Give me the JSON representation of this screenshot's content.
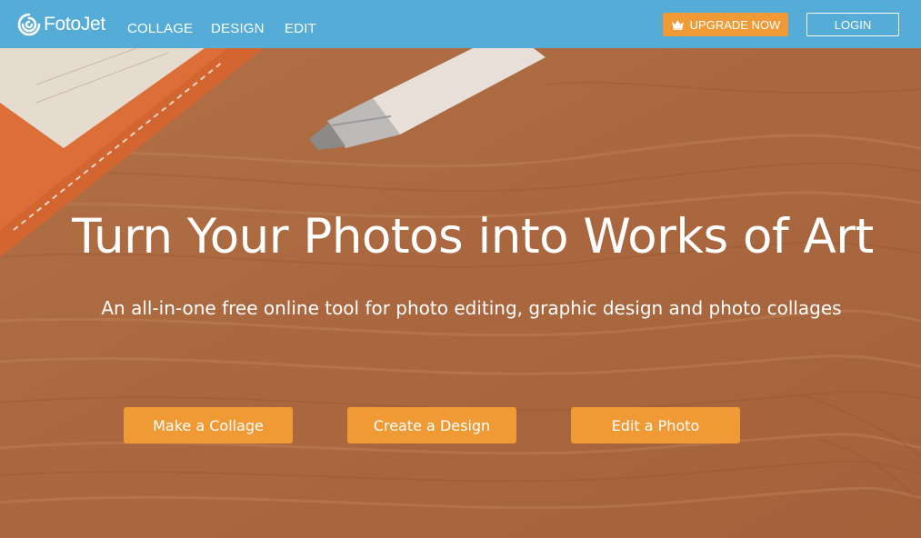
{
  "brand": {
    "name": "FotoJet",
    "logo_icon": "spiral-logo-icon"
  },
  "nav": {
    "items": [
      {
        "label": "COLLAGE"
      },
      {
        "label": "DESIGN"
      },
      {
        "label": "EDIT"
      }
    ]
  },
  "header_actions": {
    "upgrade_label": "UPGRADE NOW",
    "upgrade_icon": "crown-icon",
    "login_label": "LOGIN"
  },
  "hero": {
    "title": "Turn Your Photos into Works of Art",
    "subtitle": "An all-in-one free online tool for photo editing, graphic design and photo collages",
    "buttons": [
      {
        "label": "Make a Collage"
      },
      {
        "label": "Create a Design"
      },
      {
        "label": "Edit a Photo"
      }
    ],
    "background": "wood-desk-with-notebook-and-pen"
  },
  "colors": {
    "header": "#55acd6",
    "accent": "#f09a35",
    "text": "#ffffff",
    "wood": "#b5734a"
  }
}
